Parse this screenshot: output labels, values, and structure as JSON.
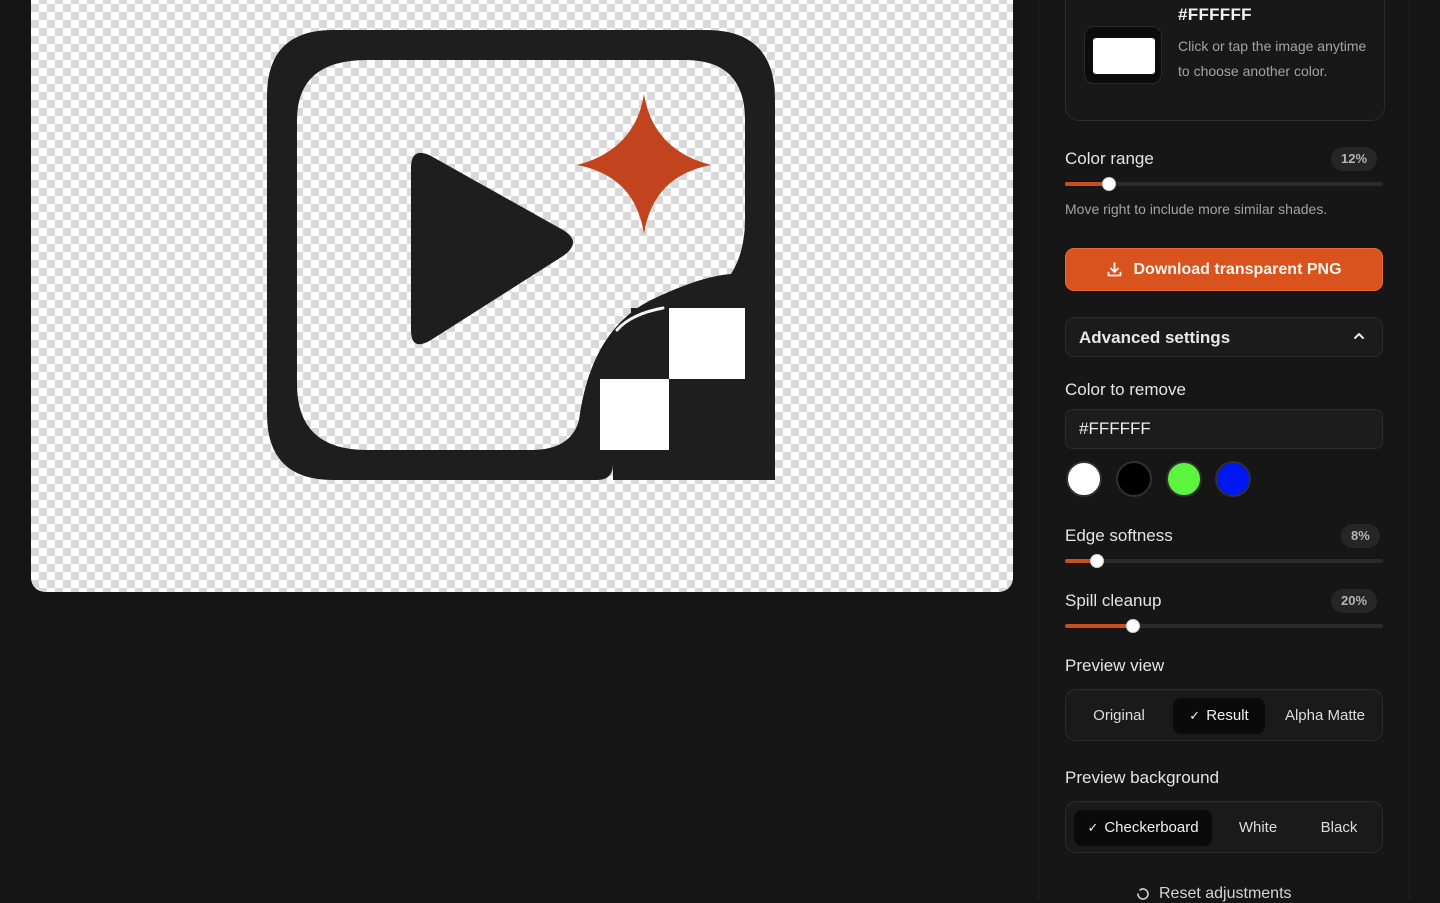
{
  "canvas": {
    "logo_colors": {
      "frame": "#1e1e1e",
      "sparkle": "#c2441f",
      "background_pattern": "checkerboard"
    }
  },
  "selected_color": {
    "hex": "#FFFFFF",
    "hint": "Click or tap the image anytime to choose another color."
  },
  "color_range": {
    "label": "Color range",
    "value_text": "12%",
    "value": 12,
    "hint": "Move right to include more similar shades."
  },
  "download_button": {
    "label": "Download transparent PNG",
    "icon": "download-icon"
  },
  "advanced_settings": {
    "label": "Advanced settings",
    "expanded": true,
    "icon": "chevron-up-icon"
  },
  "color_to_remove": {
    "label": "Color to remove",
    "value": "#FFFFFF",
    "presets": [
      {
        "name": "white",
        "color": "#ffffff"
      },
      {
        "name": "black",
        "color": "#000000"
      },
      {
        "name": "green",
        "color": "#5cf43c"
      },
      {
        "name": "blue",
        "color": "#0018f0"
      }
    ]
  },
  "edge_softness": {
    "label": "Edge softness",
    "value_text": "8%",
    "value": 8
  },
  "spill_cleanup": {
    "label": "Spill cleanup",
    "value_text": "20%",
    "value": 20
  },
  "preview_view": {
    "label": "Preview view",
    "options": [
      "Original",
      "Result",
      "Alpha Matte"
    ],
    "selected": "Result"
  },
  "preview_background": {
    "label": "Preview background",
    "options": [
      "Checkerboard",
      "White",
      "Black"
    ],
    "selected": "Checkerboard"
  },
  "reset": {
    "label": "Reset adjustments",
    "icon": "reset-icon"
  },
  "accent_color": "#d8531d"
}
